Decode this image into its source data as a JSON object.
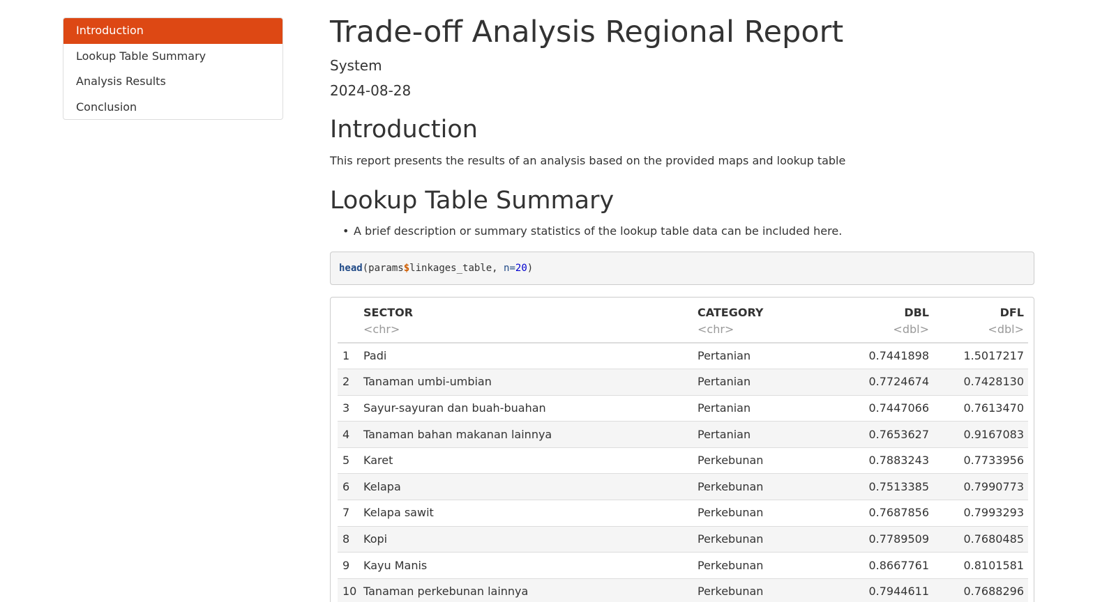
{
  "toc": {
    "items": [
      {
        "label": "Introduction",
        "active": true
      },
      {
        "label": "Lookup Table Summary",
        "active": false
      },
      {
        "label": "Analysis Results",
        "active": false
      },
      {
        "label": "Conclusion",
        "active": false
      }
    ],
    "active_color": "#dd4814"
  },
  "header": {
    "title": "Trade-off Analysis Regional Report",
    "author": "System",
    "date": "2024-08-28"
  },
  "introduction": {
    "heading": "Introduction",
    "text": "This report presents the results of an analysis based on the provided maps and lookup table"
  },
  "lookup": {
    "heading": "Lookup Table Summary",
    "bullet": "A brief description or summary statistics of the lookup table data can be included here.",
    "code": {
      "fn": "head",
      "open": "(params",
      "op": "$",
      "arg1": "linkages_table, ",
      "argname": "n",
      "eq": "=",
      "num": "20",
      "close": ")"
    }
  },
  "table": {
    "columns": [
      {
        "name": "SECTOR",
        "type": "<chr>"
      },
      {
        "name": "CATEGORY",
        "type": "<chr>"
      },
      {
        "name": "DBL",
        "type": "<dbl>"
      },
      {
        "name": "DFL",
        "type": "<dbl>"
      }
    ],
    "rows": [
      {
        "idx": "1",
        "sector": "Padi",
        "category": "Pertanian",
        "dbl": "0.7441898",
        "dfl": "1.5017217"
      },
      {
        "idx": "2",
        "sector": "Tanaman umbi-umbian",
        "category": "Pertanian",
        "dbl": "0.7724674",
        "dfl": "0.7428130"
      },
      {
        "idx": "3",
        "sector": "Sayur-sayuran dan buah-buahan",
        "category": "Pertanian",
        "dbl": "0.7447066",
        "dfl": "0.7613470"
      },
      {
        "idx": "4",
        "sector": "Tanaman bahan makanan lainnya",
        "category": "Pertanian",
        "dbl": "0.7653627",
        "dfl": "0.9167083"
      },
      {
        "idx": "5",
        "sector": "Karet",
        "category": "Perkebunan",
        "dbl": "0.7883243",
        "dfl": "0.7733956"
      },
      {
        "idx": "6",
        "sector": "Kelapa",
        "category": "Perkebunan",
        "dbl": "0.7513385",
        "dfl": "0.7990773"
      },
      {
        "idx": "7",
        "sector": "Kelapa sawit",
        "category": "Perkebunan",
        "dbl": "0.7687856",
        "dfl": "0.7993293"
      },
      {
        "idx": "8",
        "sector": "Kopi",
        "category": "Perkebunan",
        "dbl": "0.7789509",
        "dfl": "0.7680485"
      },
      {
        "idx": "9",
        "sector": "Kayu Manis",
        "category": "Perkebunan",
        "dbl": "0.8667761",
        "dfl": "0.8101581"
      },
      {
        "idx": "10",
        "sector": "Tanaman perkebunan lainnya",
        "category": "Perkebunan",
        "dbl": "0.7944611",
        "dfl": "0.7688296"
      }
    ]
  }
}
